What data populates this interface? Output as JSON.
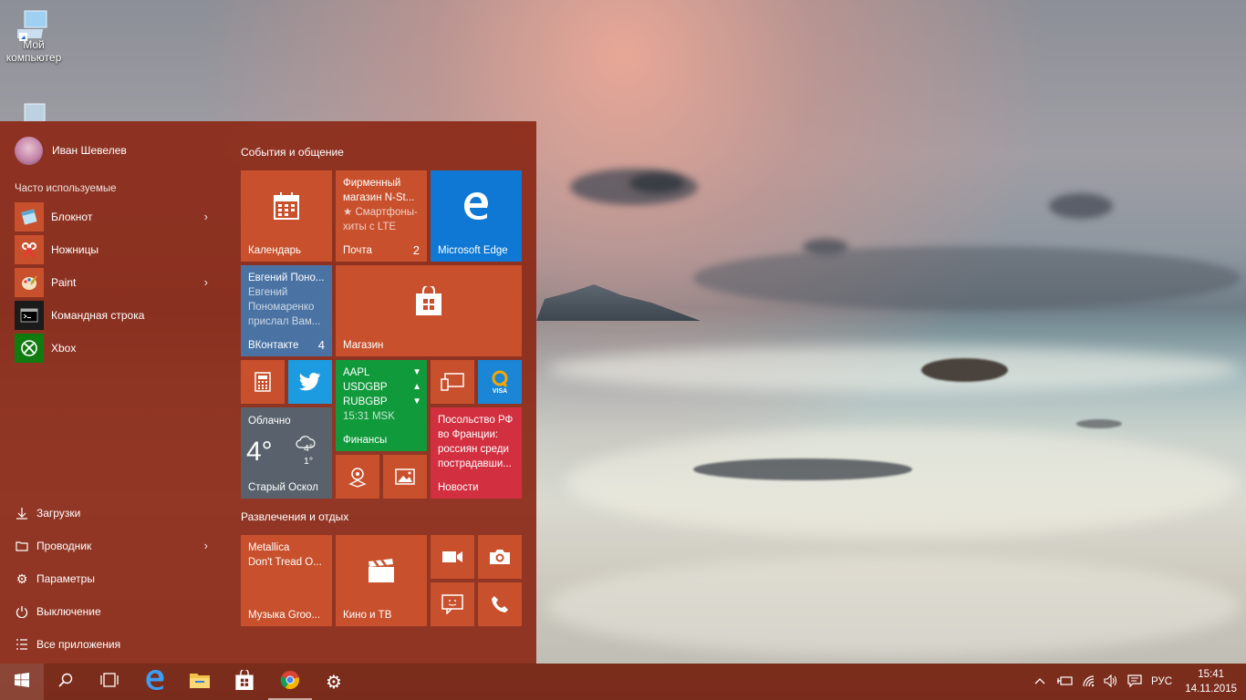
{
  "desktop": {
    "icons": [
      {
        "label": "Мой компьютер",
        "icon": "computer-icon"
      },
      {
        "label": "",
        "icon": "recycle-bin-icon"
      }
    ]
  },
  "start_menu": {
    "user_name": "Иван Шевелев",
    "most_used_label": "Часто используемые",
    "apps": [
      {
        "label": "Блокнот",
        "icon": "notepad-icon",
        "has_submenu": true
      },
      {
        "label": "Ножницы",
        "icon": "snipping-tool-icon",
        "has_submenu": false
      },
      {
        "label": "Paint",
        "icon": "paint-icon",
        "has_submenu": true
      },
      {
        "label": "Командная строка",
        "icon": "command-prompt-icon",
        "has_submenu": false
      },
      {
        "label": "Xbox",
        "icon": "xbox-icon",
        "has_submenu": false
      }
    ],
    "system_items": [
      {
        "label": "Загрузки",
        "icon": "download-icon"
      },
      {
        "label": "Проводник",
        "icon": "file-explorer-icon",
        "has_submenu": true
      },
      {
        "label": "Параметры",
        "icon": "gear-icon"
      },
      {
        "label": "Выключение",
        "icon": "power-icon"
      },
      {
        "label": "Все приложения",
        "icon": "all-apps-icon"
      }
    ],
    "groups": [
      {
        "label": "События и общение"
      },
      {
        "label": "Развлечения и отдых"
      }
    ],
    "tiles": {
      "calendar": {
        "label": "Календарь"
      },
      "mail": {
        "line1": "Фирменный",
        "line2": "магазин N-St...",
        "line3": "★ Смартфоны-",
        "line4": "хиты с LTE",
        "label": "Почта",
        "badge": "2"
      },
      "edge": {
        "label": "Microsoft Edge"
      },
      "vk": {
        "line1": "Евгений Поно...",
        "line2": "Евгений",
        "line3": "Пономаренко",
        "line4": "прислал Вам...",
        "label": "ВКонтакте",
        "badge": "4"
      },
      "store": {
        "label": "Магазин"
      },
      "finance": {
        "rows": [
          {
            "symbol": "AAPL",
            "trend": "▼"
          },
          {
            "symbol": "USDGBP",
            "trend": "▲"
          },
          {
            "symbol": "RUBGBP",
            "trend": "▼"
          }
        ],
        "time": "15:31 MSK",
        "label": "Финансы"
      },
      "weather": {
        "condition": "Облачно",
        "temp": "4°",
        "high": "4°",
        "low": "1°",
        "label": "Старый Оскол"
      },
      "news": {
        "line1": "Посольство РФ",
        "line2": "во Франции:",
        "line3": "россиян среди",
        "line4": "пострадавши...",
        "label": "Новости"
      },
      "visa_badge": "VISA",
      "music": {
        "line1": "Metallica",
        "line2": "Don't Tread O...",
        "label": "Музыка Groo..."
      },
      "movies": {
        "label": "Кино и ТВ"
      }
    },
    "colors": {
      "tile": "#c8502c",
      "edge": "#0f78d4",
      "vk": "#4a73a4",
      "twitter": "#1d9be0",
      "finance": "#119a3c",
      "news": "#d23040",
      "weather": "#59626c",
      "xbox": "#107c10"
    }
  },
  "taskbar": {
    "items": [
      "windows-logo-icon",
      "search-icon",
      "task-view-icon",
      "edge-icon",
      "folder-icon",
      "store-icon",
      "chrome-icon",
      "gear-icon"
    ],
    "language": "РУС",
    "time": "15:41",
    "date": "14.11.2015"
  }
}
